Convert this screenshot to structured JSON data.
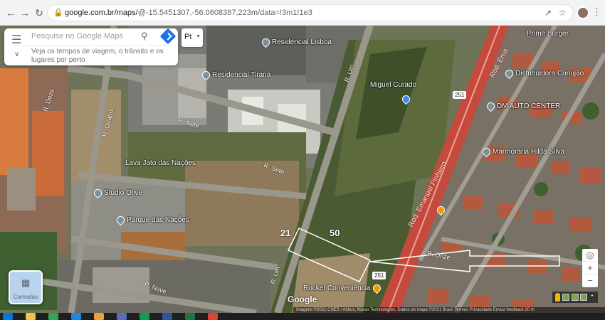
{
  "browser": {
    "back_icon": "arrow-left-icon",
    "forward_icon": "arrow-right-icon",
    "reload_icon": "reload-icon",
    "url_host": "google.com.br/maps/",
    "url_path": "@-15.5451307,-56.0608387,223m/data=!3m1!1e3"
  },
  "search": {
    "placeholder": "Pesquise no Google Maps",
    "travel_hint": "Veja os tempos de viagem, o trânsito e os lugares por perto"
  },
  "language_button": "Pt",
  "places": [
    "Residencial Lisboa",
    "Residencial Tirana",
    "Miguel Curado",
    "Distribuidora Conujão",
    "DM AUTO CENTER",
    "Marmoraria Hilda Silva",
    "Lava Jato das Nações",
    "Studio Olive",
    "Parque das Nações",
    "Rocket Conveniência",
    "Prime Burger"
  ],
  "streets": {
    "sete_a": "R. Sete",
    "sete_b": "R. Sete",
    "um_a": "R. Um",
    "um_b": "R. Um",
    "nove": "R. Nove",
    "onze": "R. Onze",
    "doze": "R. Doze",
    "quatro": "R. Quatro",
    "road_main": "Rod. Emanuel Pinheiro",
    "road_top": "Rod. Ema",
    "shield_1": "251",
    "shield_2": "251"
  },
  "lot_numbers": [
    "21",
    "50"
  ],
  "layers_label": "Camadas",
  "google_logo": "Google",
  "attribution": "Imagens ©2021 CNES / Airbus, Maxar Technologies, Dados do mapa ©2021   Brasil   Termos   Privacidade   Enviar feedback   20 m",
  "colors": {
    "highway": "#d65b4e",
    "selection_outline": "#ffffff",
    "accent_blue": "#1a73e8"
  },
  "taskbar_icons": [
    "start-icon",
    "explorer-icon",
    "chrome-icon",
    "edge-icon",
    "files-icon",
    "store-icon",
    "mail-icon",
    "word-icon",
    "excel-icon",
    "chrome-active-icon"
  ]
}
